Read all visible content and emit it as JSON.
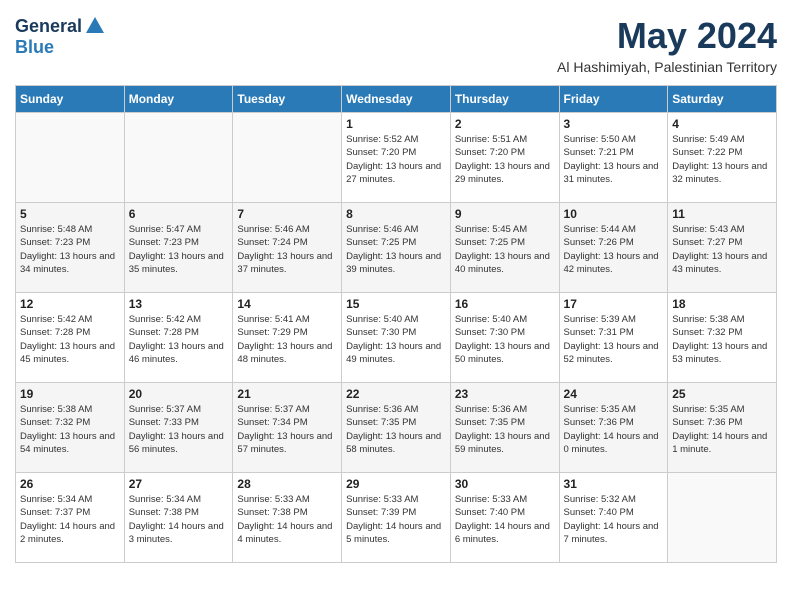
{
  "logo": {
    "general": "General",
    "blue": "Blue"
  },
  "title": "May 2024",
  "location": "Al Hashimiyah, Palestinian Territory",
  "days_header": [
    "Sunday",
    "Monday",
    "Tuesday",
    "Wednesday",
    "Thursday",
    "Friday",
    "Saturday"
  ],
  "weeks": [
    [
      {
        "day": "",
        "content": ""
      },
      {
        "day": "",
        "content": ""
      },
      {
        "day": "",
        "content": ""
      },
      {
        "day": "1",
        "content": "Sunrise: 5:52 AM\nSunset: 7:20 PM\nDaylight: 13 hours and 27 minutes."
      },
      {
        "day": "2",
        "content": "Sunrise: 5:51 AM\nSunset: 7:20 PM\nDaylight: 13 hours and 29 minutes."
      },
      {
        "day": "3",
        "content": "Sunrise: 5:50 AM\nSunset: 7:21 PM\nDaylight: 13 hours and 31 minutes."
      },
      {
        "day": "4",
        "content": "Sunrise: 5:49 AM\nSunset: 7:22 PM\nDaylight: 13 hours and 32 minutes."
      }
    ],
    [
      {
        "day": "5",
        "content": "Sunrise: 5:48 AM\nSunset: 7:23 PM\nDaylight: 13 hours and 34 minutes."
      },
      {
        "day": "6",
        "content": "Sunrise: 5:47 AM\nSunset: 7:23 PM\nDaylight: 13 hours and 35 minutes."
      },
      {
        "day": "7",
        "content": "Sunrise: 5:46 AM\nSunset: 7:24 PM\nDaylight: 13 hours and 37 minutes."
      },
      {
        "day": "8",
        "content": "Sunrise: 5:46 AM\nSunset: 7:25 PM\nDaylight: 13 hours and 39 minutes."
      },
      {
        "day": "9",
        "content": "Sunrise: 5:45 AM\nSunset: 7:25 PM\nDaylight: 13 hours and 40 minutes."
      },
      {
        "day": "10",
        "content": "Sunrise: 5:44 AM\nSunset: 7:26 PM\nDaylight: 13 hours and 42 minutes."
      },
      {
        "day": "11",
        "content": "Sunrise: 5:43 AM\nSunset: 7:27 PM\nDaylight: 13 hours and 43 minutes."
      }
    ],
    [
      {
        "day": "12",
        "content": "Sunrise: 5:42 AM\nSunset: 7:28 PM\nDaylight: 13 hours and 45 minutes."
      },
      {
        "day": "13",
        "content": "Sunrise: 5:42 AM\nSunset: 7:28 PM\nDaylight: 13 hours and 46 minutes."
      },
      {
        "day": "14",
        "content": "Sunrise: 5:41 AM\nSunset: 7:29 PM\nDaylight: 13 hours and 48 minutes."
      },
      {
        "day": "15",
        "content": "Sunrise: 5:40 AM\nSunset: 7:30 PM\nDaylight: 13 hours and 49 minutes."
      },
      {
        "day": "16",
        "content": "Sunrise: 5:40 AM\nSunset: 7:30 PM\nDaylight: 13 hours and 50 minutes."
      },
      {
        "day": "17",
        "content": "Sunrise: 5:39 AM\nSunset: 7:31 PM\nDaylight: 13 hours and 52 minutes."
      },
      {
        "day": "18",
        "content": "Sunrise: 5:38 AM\nSunset: 7:32 PM\nDaylight: 13 hours and 53 minutes."
      }
    ],
    [
      {
        "day": "19",
        "content": "Sunrise: 5:38 AM\nSunset: 7:32 PM\nDaylight: 13 hours and 54 minutes."
      },
      {
        "day": "20",
        "content": "Sunrise: 5:37 AM\nSunset: 7:33 PM\nDaylight: 13 hours and 56 minutes."
      },
      {
        "day": "21",
        "content": "Sunrise: 5:37 AM\nSunset: 7:34 PM\nDaylight: 13 hours and 57 minutes."
      },
      {
        "day": "22",
        "content": "Sunrise: 5:36 AM\nSunset: 7:35 PM\nDaylight: 13 hours and 58 minutes."
      },
      {
        "day": "23",
        "content": "Sunrise: 5:36 AM\nSunset: 7:35 PM\nDaylight: 13 hours and 59 minutes."
      },
      {
        "day": "24",
        "content": "Sunrise: 5:35 AM\nSunset: 7:36 PM\nDaylight: 14 hours and 0 minutes."
      },
      {
        "day": "25",
        "content": "Sunrise: 5:35 AM\nSunset: 7:36 PM\nDaylight: 14 hours and 1 minute."
      }
    ],
    [
      {
        "day": "26",
        "content": "Sunrise: 5:34 AM\nSunset: 7:37 PM\nDaylight: 14 hours and 2 minutes."
      },
      {
        "day": "27",
        "content": "Sunrise: 5:34 AM\nSunset: 7:38 PM\nDaylight: 14 hours and 3 minutes."
      },
      {
        "day": "28",
        "content": "Sunrise: 5:33 AM\nSunset: 7:38 PM\nDaylight: 14 hours and 4 minutes."
      },
      {
        "day": "29",
        "content": "Sunrise: 5:33 AM\nSunset: 7:39 PM\nDaylight: 14 hours and 5 minutes."
      },
      {
        "day": "30",
        "content": "Sunrise: 5:33 AM\nSunset: 7:40 PM\nDaylight: 14 hours and 6 minutes."
      },
      {
        "day": "31",
        "content": "Sunrise: 5:32 AM\nSunset: 7:40 PM\nDaylight: 14 hours and 7 minutes."
      },
      {
        "day": "",
        "content": ""
      }
    ]
  ]
}
